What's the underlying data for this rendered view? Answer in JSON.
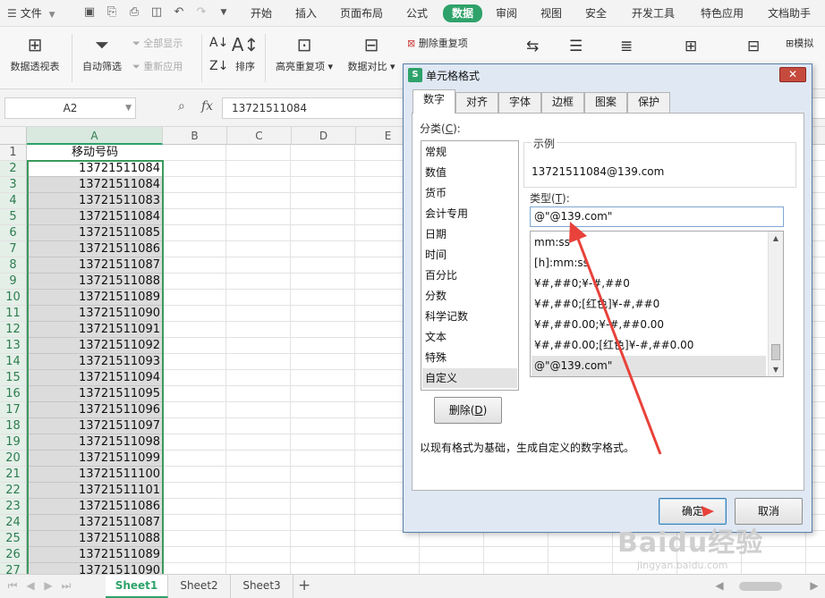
{
  "menubar": {
    "file_label": "文件",
    "tabs": [
      "开始",
      "插入",
      "页面布局",
      "公式",
      "数据",
      "审阅",
      "视图",
      "安全",
      "开发工具",
      "特色应用",
      "文档助手"
    ],
    "active_tab": "数据"
  },
  "ribbon": {
    "pivot": "数据透视表",
    "auto_filter": "自动筛选",
    "show_all": "全部显示",
    "reapply": "重新应用",
    "sort": "排序",
    "highlight_dup": "高亮重复项",
    "data_compare": "数据对比",
    "remove_dup": "删除重复项",
    "model": "模拟"
  },
  "formula_bar": {
    "name_box": "A2",
    "fx": "fx",
    "value": "13721511084"
  },
  "sheet": {
    "columns": [
      "A",
      "B",
      "C",
      "D",
      "E"
    ],
    "rows": [
      "1",
      "2",
      "3",
      "4",
      "5",
      "6",
      "7",
      "8",
      "9",
      "10",
      "11",
      "12",
      "13",
      "14",
      "15",
      "16",
      "17",
      "18",
      "19",
      "20",
      "21",
      "22",
      "23",
      "24",
      "25",
      "26",
      "27"
    ],
    "col_a_values": [
      "移动号码",
      "13721511084",
      "13721511084",
      "13721511083",
      "13721511084",
      "13721511085",
      "13721511086",
      "13721511087",
      "13721511088",
      "13721511089",
      "13721511090",
      "13721511091",
      "13721511092",
      "13721511093",
      "13721511094",
      "13721511095",
      "13721511096",
      "13721511097",
      "13721511098",
      "13721511099",
      "13721511100",
      "13721511101",
      "13721511086",
      "13721511087",
      "13721511088",
      "13721511089",
      "13721511090"
    ]
  },
  "sheet_tabs": [
    "Sheet1",
    "Sheet2",
    "Sheet3"
  ],
  "dialog": {
    "title": "单元格格式",
    "tabs": [
      "数字",
      "对齐",
      "字体",
      "边框",
      "图案",
      "保护"
    ],
    "category_label": "分类(",
    "category_key": "C",
    "category_label_end": "):",
    "categories": [
      "常规",
      "数值",
      "货币",
      "会计专用",
      "日期",
      "时间",
      "百分比",
      "分数",
      "科学记数",
      "文本",
      "特殊",
      "自定义"
    ],
    "selected_category": "自定义",
    "sample_label": "示例",
    "sample_value": "13721511084@139.com",
    "type_label": "类型(",
    "type_key": "T",
    "type_label_end": "):",
    "type_value": "@\"@139.com\"",
    "type_options": [
      "mm:ss",
      "[h]:mm:ss",
      "¥#,##0;¥-#,##0",
      "¥#,##0;[红色]¥-#,##0",
      "¥#,##0.00;¥-#,##0.00",
      "¥#,##0.00;[红色]¥-#,##0.00",
      "@\"@139.com\""
    ],
    "delete_button": "删除(",
    "delete_key": "D",
    "delete_end": ")",
    "hint": "以现有格式为基础，生成自定义的数字格式。",
    "ok": "确定",
    "cancel": "取消"
  },
  "watermark": {
    "big": "Baidu经验",
    "small": "jingyan.baidu.com"
  },
  "colors": {
    "accent": "#2ea26a",
    "annotation": "#e8423a"
  }
}
